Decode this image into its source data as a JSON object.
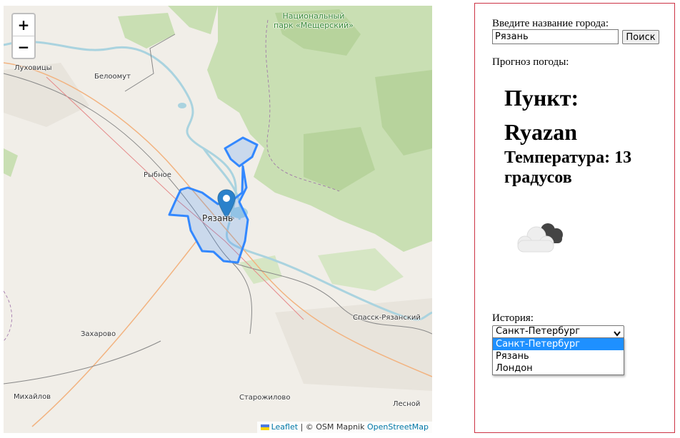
{
  "map": {
    "zoom_in_label": "+",
    "zoom_out_label": "−",
    "labels": {
      "park": "Национальный\nпарк «Мещерский»",
      "lukhovitsy": "Луховицы",
      "beloomut": "Белоомут",
      "rybnoe": "Рыбное",
      "ryazan": "Рязань",
      "spassk": "Спасск-Рязанский",
      "zakharovo": "Захарово",
      "mikhaylov": "Михайлов",
      "starozhilovo": "Старожилово",
      "lesnoy": "Лесной"
    },
    "attribution": {
      "leaflet": "Leaflet",
      "sep": " | © OSM Mapnik ",
      "osm": "OpenStreetMap"
    },
    "colors": {
      "boundary": "#3388ff",
      "forest": "#c7dfb0",
      "water": "#aad3df"
    }
  },
  "panel": {
    "city_prompt": "Введите название города:",
    "city_value": "Рязань",
    "search_label": "Поиск",
    "forecast_label": "Прогноз погоды:",
    "place_heading": "Пункт: Ryazan",
    "temperature_heading": "Температура: 13 градусов",
    "weather_icon": "cloudy-icon",
    "history_label": "История:",
    "history_selected": "Санкт-Петербург",
    "history_options": [
      "Санкт-Петербург",
      "Рязань",
      "Лондон"
    ]
  }
}
